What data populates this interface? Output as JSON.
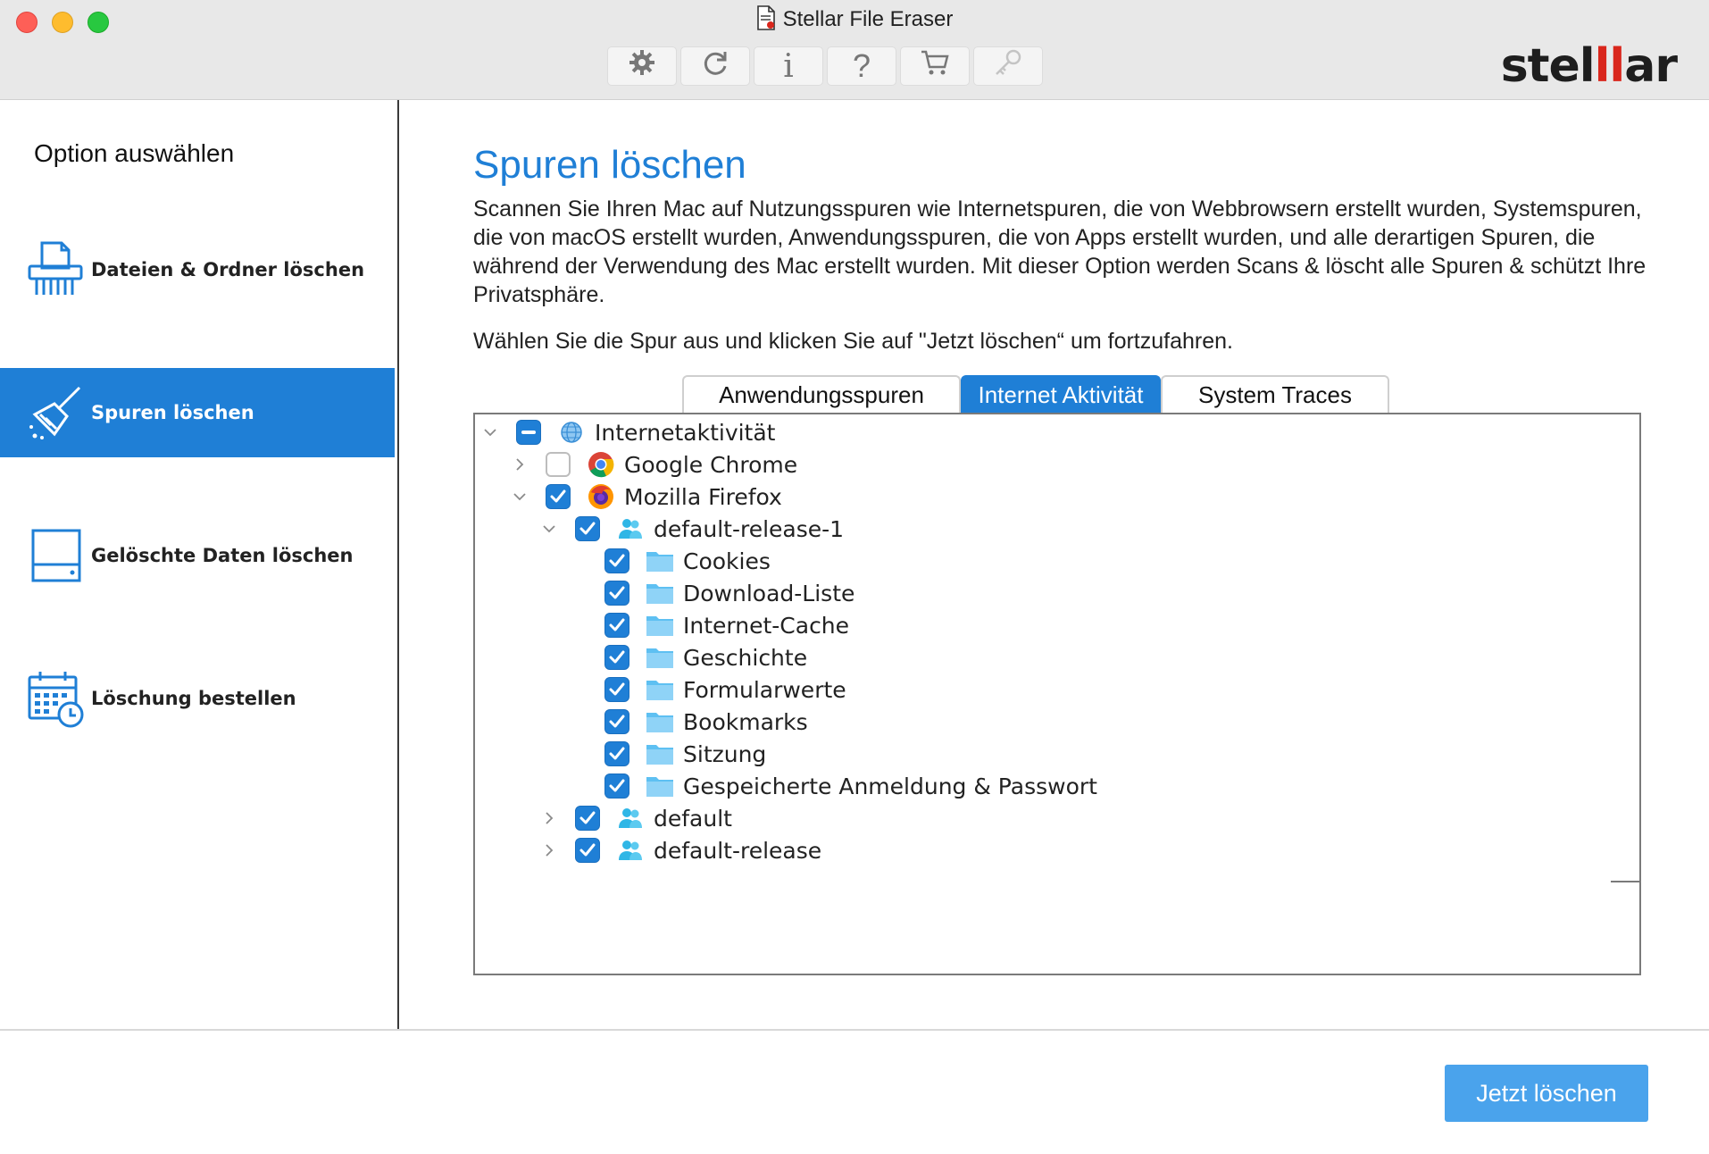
{
  "window": {
    "title": "Stellar File Eraser",
    "brand": "stellar"
  },
  "toolbar": {
    "buttons": [
      {
        "icon": "gear-icon",
        "glyph": "⚙"
      },
      {
        "icon": "refresh-icon",
        "glyph": "⟳"
      },
      {
        "icon": "info-icon",
        "glyph": "i"
      },
      {
        "icon": "help-icon",
        "glyph": "?"
      },
      {
        "icon": "cart-icon",
        "glyph": ""
      },
      {
        "icon": "key-icon",
        "glyph": ""
      }
    ]
  },
  "sidebar": {
    "title": "Option auswählen",
    "items": [
      {
        "label": "Dateien & Ordner löschen",
        "icon": "shredder-icon",
        "active": false
      },
      {
        "label": "Spuren löschen",
        "icon": "broom-icon",
        "active": true
      },
      {
        "label": "Gelöschte Daten löschen",
        "icon": "drive-icon",
        "active": false
      },
      {
        "label": "Löschung bestellen",
        "icon": "calendar-clock-icon",
        "active": false
      }
    ]
  },
  "main": {
    "heading": "Spuren löschen",
    "description": "Scannen Sie Ihren Mac auf Nutzungsspuren wie Internetspuren, die von Webbrowsern erstellt wurden, Systemspuren, die von macOS erstellt wurden, Anwendungsspuren, die von Apps erstellt wurden, und alle derartigen Spuren, die während der Verwendung des Mac erstellt wurden. Mit dieser Option werden Scans & löscht alle Spuren & schützt Ihre Privatsphäre.",
    "instruction": "Wählen Sie die Spur aus und klicken Sie auf \"Jetzt löschen“ um fortzufahren.",
    "tabs": [
      {
        "label": "Anwendungsspuren",
        "active": false
      },
      {
        "label": "Internet Aktivität",
        "active": true
      },
      {
        "label": "System Traces",
        "active": false
      }
    ],
    "tree": [
      {
        "label": "Internetaktivität",
        "level": 0,
        "expander": "down",
        "check": "mixed",
        "icon": "globe-icon"
      },
      {
        "label": "Google Chrome",
        "level": 1,
        "expander": "right",
        "check": "off",
        "icon": "chrome-icon"
      },
      {
        "label": "Mozilla Firefox",
        "level": 1,
        "expander": "down",
        "check": "on",
        "icon": "firefox-icon"
      },
      {
        "label": "default-release-1",
        "level": 2,
        "expander": "down",
        "check": "on",
        "icon": "users-icon"
      },
      {
        "label": "Cookies",
        "level": 3,
        "expander": "",
        "check": "on",
        "icon": "folder-icon"
      },
      {
        "label": "Download-Liste",
        "level": 3,
        "expander": "",
        "check": "on",
        "icon": "folder-icon"
      },
      {
        "label": "Internet-Cache",
        "level": 3,
        "expander": "",
        "check": "on",
        "icon": "folder-icon"
      },
      {
        "label": "Geschichte",
        "level": 3,
        "expander": "",
        "check": "on",
        "icon": "folder-icon"
      },
      {
        "label": "Formularwerte",
        "level": 3,
        "expander": "",
        "check": "on",
        "icon": "folder-icon"
      },
      {
        "label": "Bookmarks",
        "level": 3,
        "expander": "",
        "check": "on",
        "icon": "folder-icon"
      },
      {
        "label": "Sitzung",
        "level": 3,
        "expander": "",
        "check": "on",
        "icon": "folder-icon"
      },
      {
        "label": "Gespeicherte Anmeldung & Passwort",
        "level": 3,
        "expander": "",
        "check": "on",
        "icon": "folder-icon"
      },
      {
        "label": "default",
        "level": 2,
        "expander": "right",
        "check": "on",
        "icon": "users-icon"
      },
      {
        "label": "default-release",
        "level": 2,
        "expander": "right",
        "check": "on",
        "icon": "users-icon"
      }
    ]
  },
  "footer": {
    "primary_button": "Jetzt löschen"
  },
  "colors": {
    "accent": "#1f7fd6",
    "button": "#4aa3ec",
    "folder": "#5ec0f2"
  }
}
